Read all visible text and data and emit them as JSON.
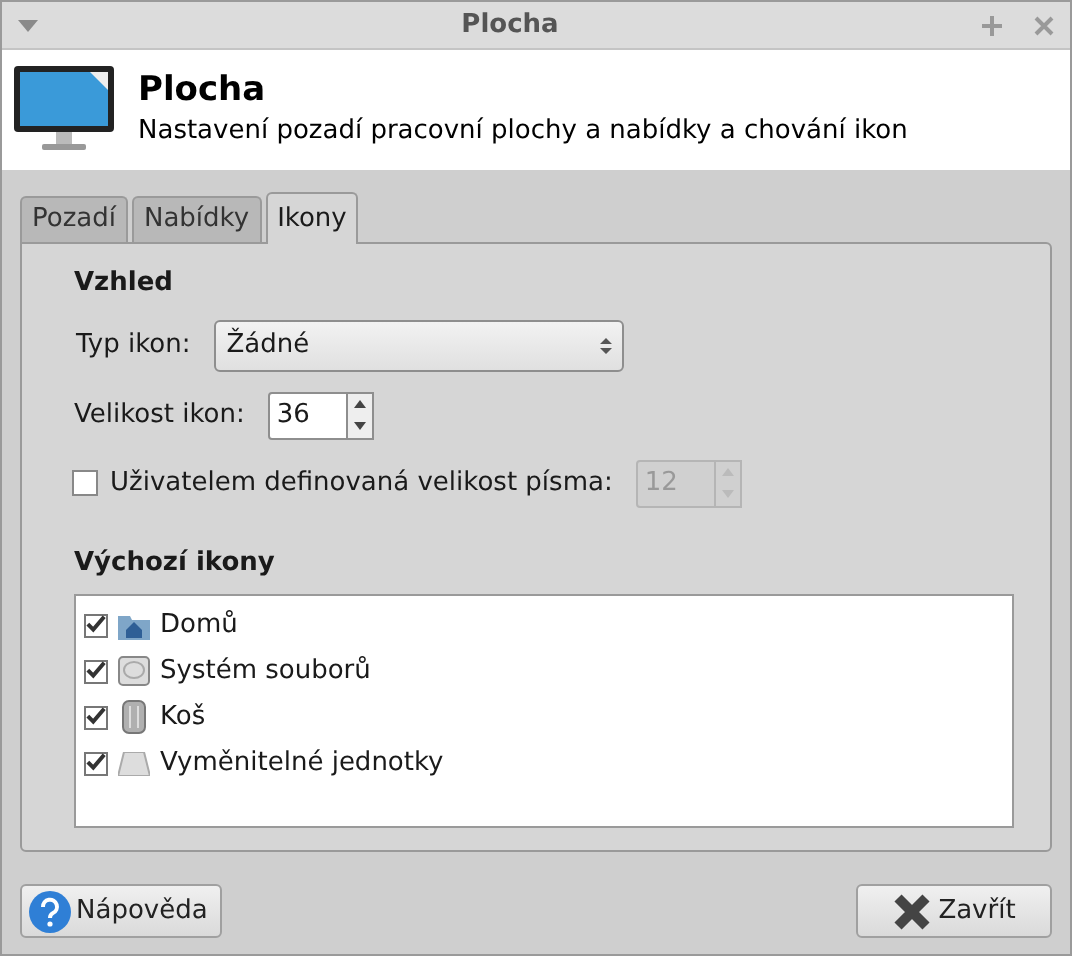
{
  "window": {
    "title": "Plocha"
  },
  "header": {
    "title": "Plocha",
    "subtitle": "Nastavení pozadí pracovní plochy a nabídky a chování ikon"
  },
  "tabs": [
    {
      "label": "Pozadí",
      "selected": false
    },
    {
      "label": "Nabídky",
      "selected": false
    },
    {
      "label": "Ikony",
      "selected": true
    }
  ],
  "appearance": {
    "heading": "Vzhled",
    "icon_type": {
      "label": "Typ ikon:",
      "value": "Žádné"
    },
    "icon_size": {
      "label": "Velikost ikon:",
      "value": "36"
    },
    "custom_font": {
      "label": "Uživatelem definovaná velikost písma:",
      "checked": false,
      "value": "12",
      "disabled": true
    }
  },
  "default_icons": {
    "heading": "Výchozí ikony",
    "items": [
      {
        "label": "Domů",
        "checked": true,
        "kind": "home"
      },
      {
        "label": "Systém souborů",
        "checked": true,
        "kind": "drive"
      },
      {
        "label": "Koš",
        "checked": true,
        "kind": "trash"
      },
      {
        "label": "Vyměnitelné jednotky",
        "checked": true,
        "kind": "removable"
      }
    ]
  },
  "buttons": [
    {
      "label": "Nápověda",
      "kind": "help"
    },
    {
      "label": "Zavřít",
      "kind": "close"
    }
  ]
}
